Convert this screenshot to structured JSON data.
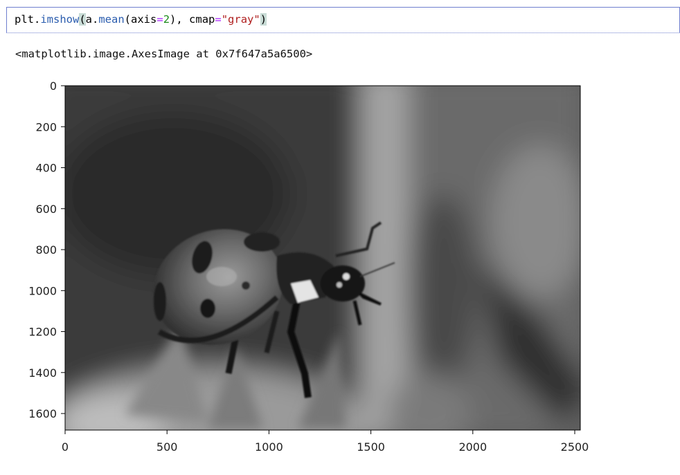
{
  "cell": {
    "code_tokens": {
      "a": "plt.",
      "b": "imshow",
      "c": "(",
      "d": "a.",
      "e": "mean",
      "f": "(axis",
      "g": "=",
      "h": "2",
      "i": "), cmap",
      "j": "=",
      "k": "\"gray\"",
      "l": ")"
    }
  },
  "output": {
    "repr": "<matplotlib.image.AxesImage at 0x7f647a5a6500>"
  },
  "plot": {
    "type": "image",
    "cmap": "gray",
    "x_ticks": [
      "0",
      "500",
      "1000",
      "1500",
      "2000",
      "2500"
    ],
    "y_ticks": [
      "0",
      "200",
      "400",
      "600",
      "800",
      "1000",
      "1200",
      "1400",
      "1600"
    ],
    "x_tick_values": [
      0,
      500,
      1000,
      1500,
      2000,
      2500
    ],
    "y_tick_values": [
      0,
      200,
      400,
      600,
      800,
      1000,
      1200,
      1400,
      1600
    ],
    "subject": "ladybug"
  }
}
